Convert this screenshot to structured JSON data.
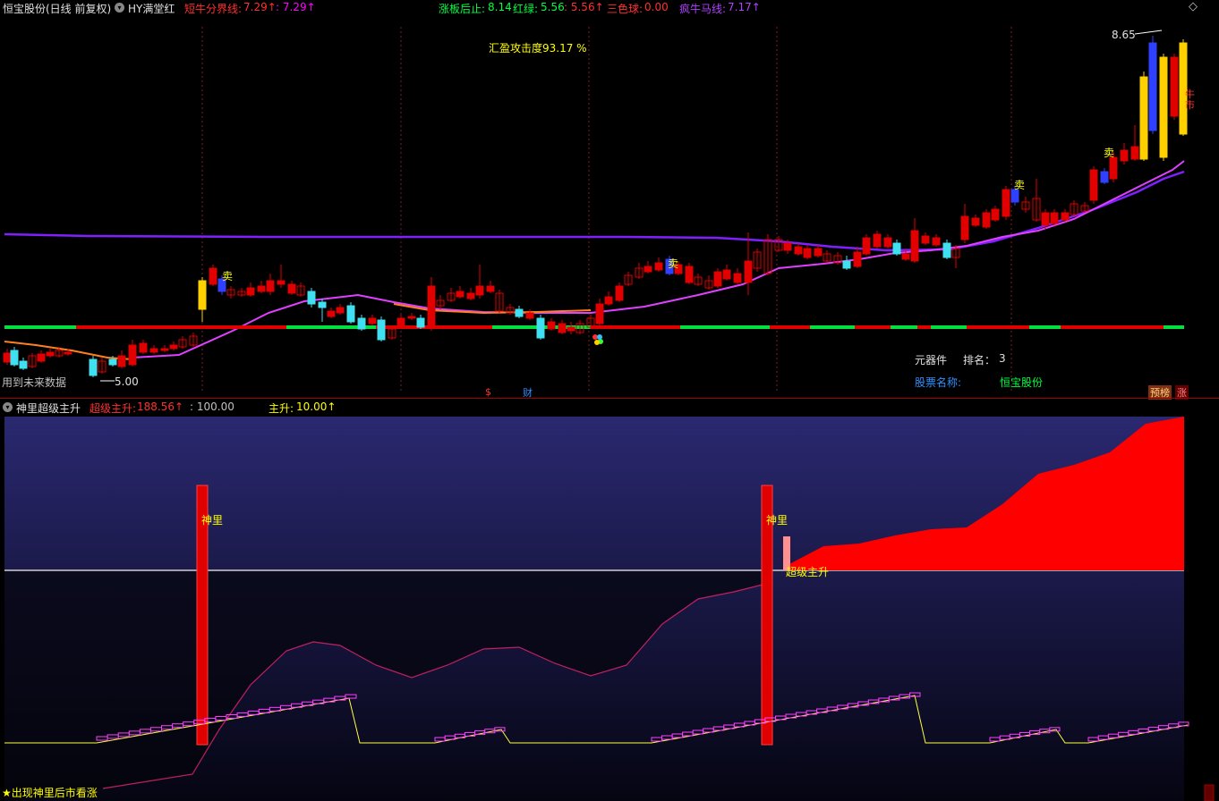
{
  "header": {
    "stock_title": "恒宝股份(日线 前复权)",
    "indicator_name": "HY满堂红",
    "line1_label": "短牛分界线:",
    "line1_value": "7.29↑",
    "line1_value2": ": 7.29↑",
    "limit_label": "涨板后止:",
    "limit_value": "8.14",
    "redgreen_label": "红绿:",
    "redgreen_value": "5.56",
    "redgreen_value2": ": 5.56↑",
    "tricolor_label": "三色球:",
    "tricolor_value": "0.00",
    "crazy_label": "疯牛马线:",
    "crazy_value": "7.17↑",
    "diamond_icon": "diamond-icon"
  },
  "main_chart": {
    "attack_text": "汇盈攻击度93.17 %",
    "high_price": "8.65",
    "low_price": "5.00",
    "future_data_text": "用到未来数据",
    "sell_markers": [
      "卖",
      "卖",
      "卖",
      "卖"
    ],
    "bull_market_text": "牛市",
    "dollar_marker": "$",
    "finance_marker": "财",
    "sector_label": "元器件",
    "rank_label": "排名：",
    "rank_value": "3",
    "stock_name_label": "股票名称:",
    "stock_name_value": "恒宝股份",
    "badge_forecast": "预榜",
    "badge_rise": "涨"
  },
  "lower_panel": {
    "title": "神里超级主升",
    "super_label": "超级主升:",
    "super_value": "188.56↑",
    "level_value": ": 100.00",
    "main_label": "主升:",
    "main_value": "10.00↑",
    "shenli_marker": "神里",
    "super_rise_text": "超级主升",
    "footer_tip": "★出现神里后市看涨"
  },
  "colors": {
    "background": "#000000",
    "up_candle": "#e00000",
    "down_candle": "#40e0f0",
    "ma_orange": "#ff8020",
    "ma_magenta": "#e040ff",
    "ma_purple": "#8020ff",
    "panel_gradient_top": "#2a2870",
    "panel_fill_red": "#ff0000"
  }
}
